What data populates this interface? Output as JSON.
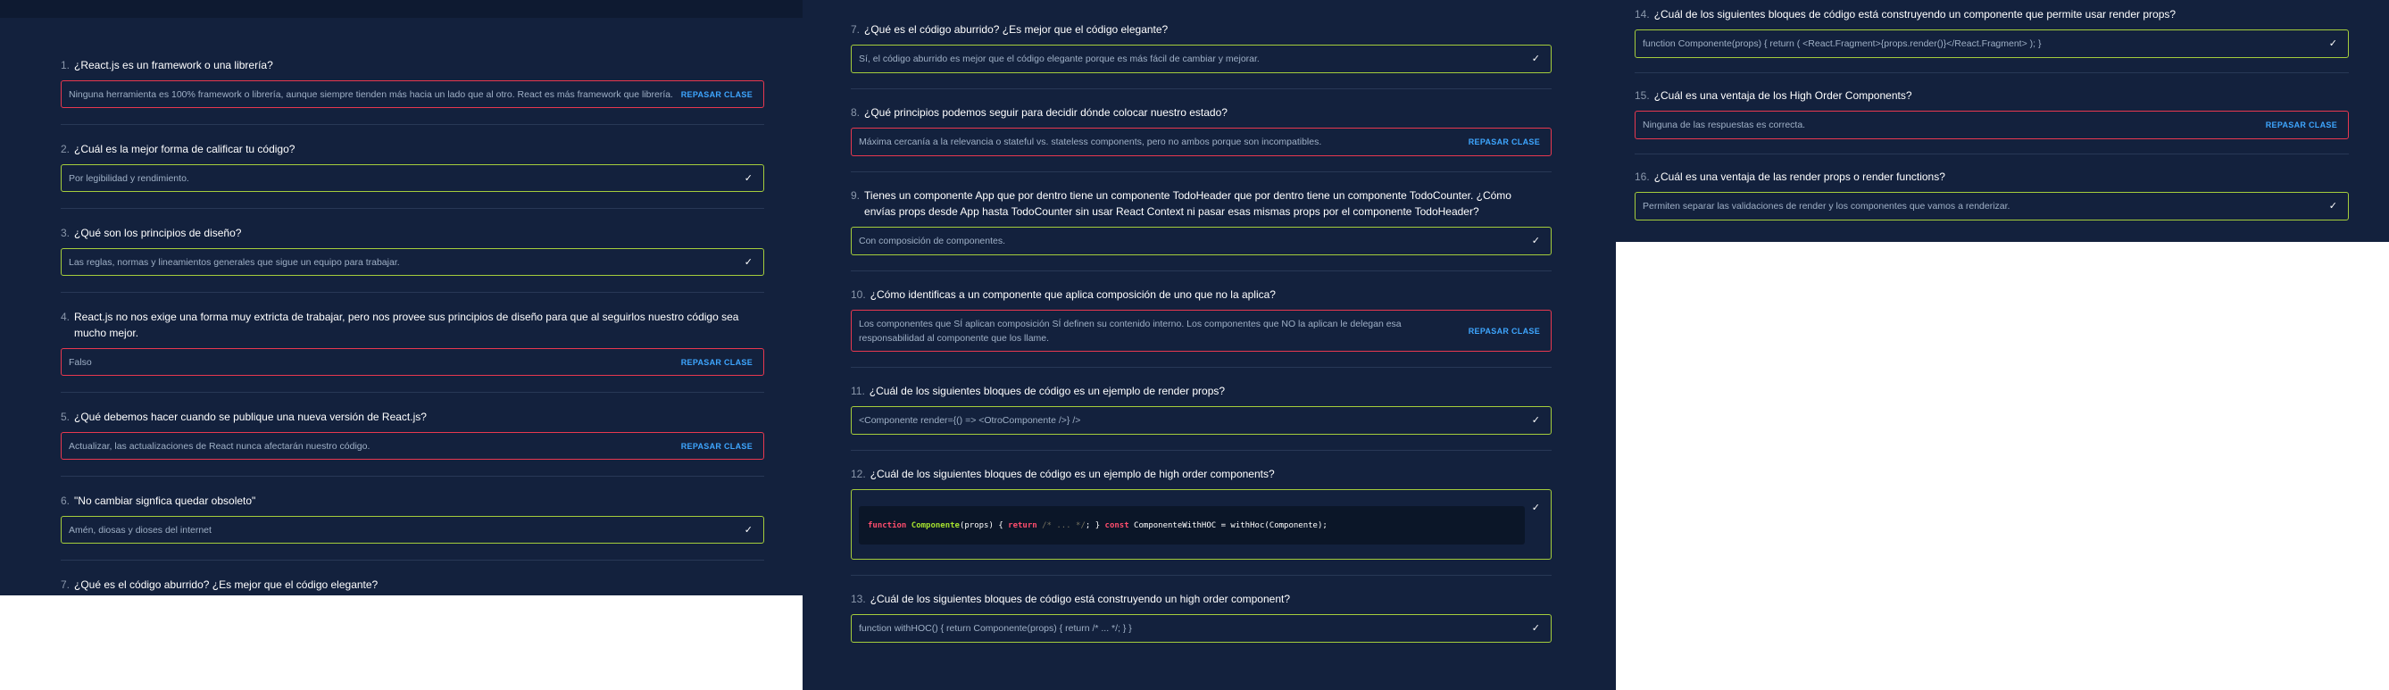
{
  "labels": {
    "review": "REPASAR CLASE",
    "check_glyph": "✓"
  },
  "colors": {
    "background": "#13213d",
    "correct": "#a5cd3c",
    "incorrect": "#e8384f",
    "review_link": "#3ea6ff"
  },
  "questions": [
    {
      "num": "1.",
      "title": "¿React.js es un framework o una librería?",
      "answer": "Ninguna herramienta es 100% framework o librería, aunque siempre tienden más hacia un lado que al otro. React es más framework que librería.",
      "status": "incorrect"
    },
    {
      "num": "2.",
      "title": "¿Cuál es la mejor forma de calificar tu código?",
      "answer": "Por legibilidad y rendimiento.",
      "status": "correct"
    },
    {
      "num": "3.",
      "title": "¿Qué son los principios de diseño?",
      "answer": "Las reglas, normas y lineamientos generales que sigue un equipo para trabajar.",
      "status": "correct"
    },
    {
      "num": "4.",
      "title": "React.js no nos exige una forma muy extricta de trabajar, pero nos provee sus principios de diseño para que al seguirlos nuestro código sea mucho mejor.",
      "answer": "Falso",
      "status": "incorrect"
    },
    {
      "num": "5.",
      "title": "¿Qué debemos hacer cuando se publique una nueva versión de React.js?",
      "answer": "Actualizar, las actualizaciones de React nunca afectarán nuestro código.",
      "status": "incorrect"
    },
    {
      "num": "6.",
      "title": "\"No cambiar signfica quedar obsoleto\"",
      "answer": "Amén, diosas y dioses del internet",
      "status": "correct"
    },
    {
      "num": "7.",
      "title": "¿Qué es el código aburrido? ¿Es mejor que el código elegante?",
      "answer": "Sí, el código aburrido es mejor que el código elegante porque es más fácil de cambiar y mejorar.",
      "status": "correct"
    },
    {
      "num": "8.",
      "title": "¿Qué principios podemos seguir para decidir dónde colocar nuestro estado?",
      "answer": "Máxima cercanía a la relevancia o stateful vs. stateless components, pero no ambos porque son incompatibles.",
      "status": "incorrect"
    },
    {
      "num": "9.",
      "title": "Tienes un componente App que por dentro tiene un componente TodoHeader que por dentro tiene un componente TodoCounter. ¿Cómo envías props desde App hasta TodoCounter sin usar React Context ni pasar esas mismas props por el componente TodoHeader?",
      "answer": "Con composición de componentes.",
      "status": "correct"
    },
    {
      "num": "10.",
      "title": "¿Cómo identificas a un componente que aplica composición de uno que no la aplica?",
      "answer": "Los componentes que SÍ aplican composición SÍ definen su contenido interno. Los componentes que NO la aplican le delegan esa responsabilidad al componente que los llame.",
      "status": "incorrect"
    },
    {
      "num": "11.",
      "title": "¿Cuál de los siguientes bloques de código es un ejemplo de render props?",
      "answer": "<Componente render={() => <OtroComponente />} />",
      "status": "correct"
    },
    {
      "num": "12.",
      "title": "¿Cuál de los siguientes bloques de código es un ejemplo de high order components?",
      "status": "correct",
      "code": {
        "t1": "function",
        "t2": "Componente",
        "t3": "(props) { ",
        "t4": "return",
        "t5": " /* ... */",
        "t6": "; } ",
        "t7": "const",
        "t8": " ComponenteWithHOC = withHoc(Componente);"
      }
    },
    {
      "num": "13.",
      "title": "¿Cuál de los siguientes bloques de código está construyendo un high order component?",
      "answer": "function withHOC() { return Componente(props) { return /* ... */; } }",
      "status": "correct"
    },
    {
      "num": "14.",
      "title": "¿Cuál de los siguientes bloques de código está construyendo un componente que permite usar render props?",
      "answer": "function Componente(props) { return ( <React.Fragment>{props.render()}</React.Fragment> ); }",
      "status": "correct"
    },
    {
      "num": "15.",
      "title": "¿Cuál es una ventaja de los High Order Components?",
      "answer": "Ninguna de las respuestas es correcta.",
      "status": "incorrect"
    },
    {
      "num": "16.",
      "title": "¿Cuál es una ventaja de las render props o render functions?",
      "answer": "Permiten separar las validaciones de render y los componentes que vamos a renderizar.",
      "status": "correct"
    }
  ]
}
